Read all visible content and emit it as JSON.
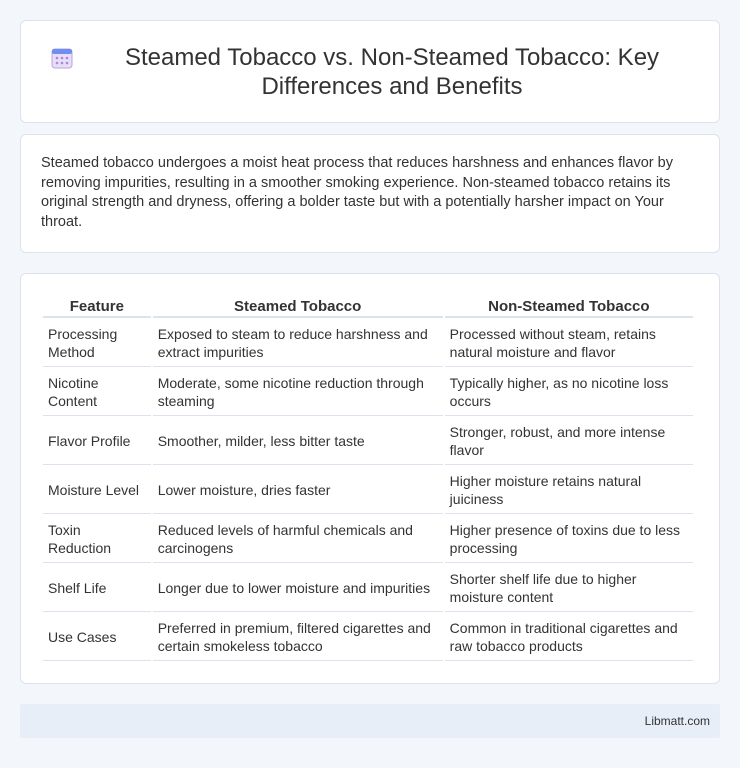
{
  "header": {
    "title": "Steamed Tobacco vs. Non-Steamed Tobacco: Key Differences and Benefits",
    "icon": "calendar-icon"
  },
  "intro": {
    "text": "Steamed tobacco undergoes a moist heat process that reduces harshness and enhances flavor by removing impurities, resulting in a smoother smoking experience. Non-steamed tobacco retains its original strength and dryness, offering a bolder taste but with a potentially harsher impact on Your throat."
  },
  "table": {
    "headers": [
      "Feature",
      "Steamed Tobacco",
      "Non-Steamed Tobacco"
    ],
    "rows": [
      [
        "Processing Method",
        "Exposed to steam to reduce harshness and extract impurities",
        "Processed without steam, retains natural moisture and flavor"
      ],
      [
        "Nicotine Content",
        "Moderate, some nicotine reduction through steaming",
        "Typically higher, as no nicotine loss occurs"
      ],
      [
        "Flavor Profile",
        "Smoother, milder, less bitter taste",
        "Stronger, robust, and more intense flavor"
      ],
      [
        "Moisture Level",
        "Lower moisture, dries faster",
        "Higher moisture retains natural juiciness"
      ],
      [
        "Toxin Reduction",
        "Reduced levels of harmful chemicals and carcinogens",
        "Higher presence of toxins due to less processing"
      ],
      [
        "Shelf Life",
        "Longer due to lower moisture and impurities",
        "Shorter shelf life due to higher moisture content"
      ],
      [
        "Use Cases",
        "Preferred in premium, filtered cigarettes and certain smokeless tobacco",
        "Common in traditional cigarettes and raw tobacco products"
      ]
    ]
  },
  "footer": {
    "brand": "Libmatt.com"
  }
}
